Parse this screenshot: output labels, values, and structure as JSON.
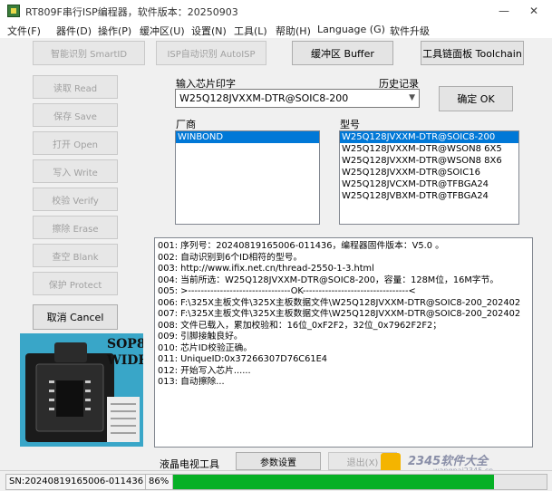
{
  "window": {
    "title": "RT809F串行ISP编程器，软件版本：20250903"
  },
  "menu": [
    "文件(F)",
    "器件(D)",
    "操作(P)",
    "缓冲区(U)",
    "设置(N)",
    "工具(L)",
    "帮助(H)",
    "Language (G)",
    "软件升级"
  ],
  "toolbar": {
    "smart_id": "智能识别 SmartID",
    "auto_isp": "ISP自动识别 AutoISP",
    "buffer": "缓冲区 Buffer",
    "toolchain": "工具链面板 Toolchain"
  },
  "left_buttons": [
    "读取 Read",
    "保存 Save",
    "打开 Open",
    "写入 Write",
    "校验 Verify",
    "擦除 Erase",
    "查空 Blank",
    "保护 Protect"
  ],
  "cancel_label": "取消 Cancel",
  "socket_image": {
    "line1": "SOP8",
    "line2": "WIDE"
  },
  "chip_input": {
    "label": "输入芯片印字",
    "history_label": "历史记录",
    "value": "W25Q128JVXXM-DTR@SOIC8-200"
  },
  "ok_button": "确定 OK",
  "vendor": {
    "label": "厂商",
    "items": [
      "WINBOND"
    ],
    "selected": 0
  },
  "model": {
    "label": "型号",
    "items": [
      "W25Q128JVXXM-DTR@SOIC8-200",
      "W25Q128JVXXM-DTR@WSON8 6X5",
      "W25Q128JVXXM-DTR@WSON8 8X6",
      "W25Q128JVXXM-DTR@SOIC16",
      "W25Q128JVCXM-DTR@TFBGA24",
      "W25Q128JVBXM-DTR@TFBGA24"
    ],
    "selected": 0
  },
  "log": [
    "001: 序列号：20240819165006-011436，编程器固件版本：V5.0 。",
    "002: 自动识别到6个ID相符的型号。",
    "003: http://www.ifix.net.cn/thread-2550-1-3.html",
    "004: 当前所选：W25Q128JVXXM-DTR@SOIC8-200，容量：128M位，16M字节。",
    "005: >--------------------------------OK---------------------------------<",
    "006: F:\\325X主板文件\\325X主板数据文件\\W25Q128JVXXM-DTR@SOIC8-200_202402",
    "007: F:\\325X主板文件\\325X主板数据文件\\W25Q128JVXXM-DTR@SOIC8-200_202402",
    "008: 文件已载入，累加校验和：16位_0xF2F2，32位_0x7962F2F2；",
    "009: 引脚接触良好。",
    "010: 芯片ID校验正确。",
    "011: UniqueID:0x37266307D76C61E4",
    "012: 开始写入芯片......",
    "013: 自动擦除..."
  ],
  "bottom": {
    "lcd_tool": "液晶电视工具",
    "params": "参数设置",
    "exit": "退出(X)",
    "watermark": "2345软件大全",
    "watermark_url": "wangpai2345.cn"
  },
  "status": {
    "serial": "SN:20240819165006-011436",
    "progress_text": "86%",
    "progress": 0.86
  },
  "colors": {
    "selection": "#0078d7",
    "progress": "#06b025"
  }
}
